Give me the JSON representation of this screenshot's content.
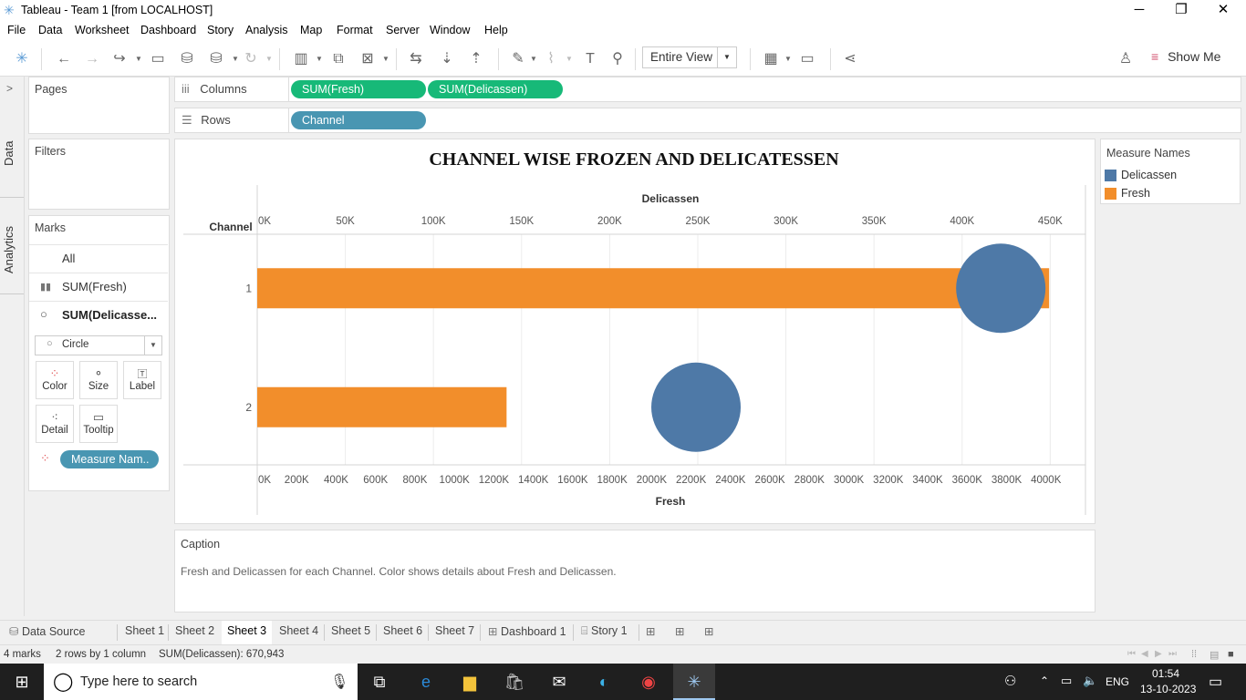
{
  "window": {
    "title": "Tableau - Team 1 [from LOCALHOST]"
  },
  "menu": [
    "File",
    "Data",
    "Worksheet",
    "Dashboard",
    "Story",
    "Analysis",
    "Map",
    "Format",
    "Server",
    "Window",
    "Help"
  ],
  "toolbar": {
    "view_select": "Entire View",
    "show_me": "Show Me"
  },
  "side_tabs": {
    "data": "Data",
    "analytics": "Analytics"
  },
  "cards": {
    "pages": "Pages",
    "filters": "Filters",
    "marks": {
      "title": "Marks",
      "all": "All",
      "sum_fresh": "SUM(Fresh)",
      "sum_deli": "SUM(Delicasse...",
      "mark_type": "Circle",
      "buttons": [
        "Color",
        "Size",
        "Label",
        "Detail",
        "Tooltip"
      ],
      "color_pill": "Measure Nam.."
    }
  },
  "shelves": {
    "columns_label": "Columns",
    "columns": [
      "SUM(Fresh)",
      "SUM(Delicassen)"
    ],
    "rows_label": "Rows",
    "rows": [
      "Channel"
    ]
  },
  "viz": {
    "title": "CHANNEL WISE FROZEN AND DELICATESSEN",
    "row_header": "Channel"
  },
  "chart_data": {
    "type": "bar",
    "title": "CHANNEL WISE FROZEN AND DELICATESSEN",
    "categories": [
      "1",
      "2"
    ],
    "series": [
      {
        "name": "Fresh",
        "mark": "bar",
        "axis": "bottom",
        "values": [
          4015717,
          1264414
        ],
        "color": "#f28e2b"
      },
      {
        "name": "Delicassen",
        "mark": "circle",
        "axis": "top",
        "values": [
          421955,
          248988
        ],
        "color": "#4e79a7"
      }
    ],
    "top_axis": {
      "label": "Delicassen",
      "range": [
        0,
        470000
      ],
      "ticks": [
        "0K",
        "50K",
        "100K",
        "150K",
        "200K",
        "250K",
        "300K",
        "350K",
        "400K",
        "450K"
      ]
    },
    "bottom_axis": {
      "label": "Fresh",
      "range": [
        0,
        4200000
      ],
      "ticks": [
        "0K",
        "200K",
        "400K",
        "600K",
        "800K",
        "1000K",
        "1200K",
        "1400K",
        "1600K",
        "1800K",
        "2000K",
        "2200K",
        "2400K",
        "2600K",
        "2800K",
        "3000K",
        "3200K",
        "3400K",
        "3600K",
        "3800K",
        "4000K"
      ]
    },
    "legend": {
      "title": "Measure Names",
      "position": "right",
      "items": [
        "Delicassen",
        "Fresh"
      ]
    }
  },
  "caption": {
    "title": "Caption",
    "text": "Fresh and Delicassen for each Channel.  Color shows details about Fresh and Delicassen."
  },
  "sheet_tabs": {
    "data_source": "Data Source",
    "sheets": [
      "Sheet 1",
      "Sheet 2",
      "Sheet 3",
      "Sheet 4",
      "Sheet 5",
      "Sheet 6",
      "Sheet 7"
    ],
    "active": "Sheet 3",
    "dashboard": "Dashboard 1",
    "story": "Story 1"
  },
  "status": {
    "marks": "4 marks",
    "dims": "2 rows by 1 column",
    "sum": "SUM(Delicassen): 670,943"
  },
  "taskbar": {
    "search_placeholder": "Type here to search",
    "lang": "ENG",
    "time": "01:54",
    "date": "13-10-2023"
  }
}
